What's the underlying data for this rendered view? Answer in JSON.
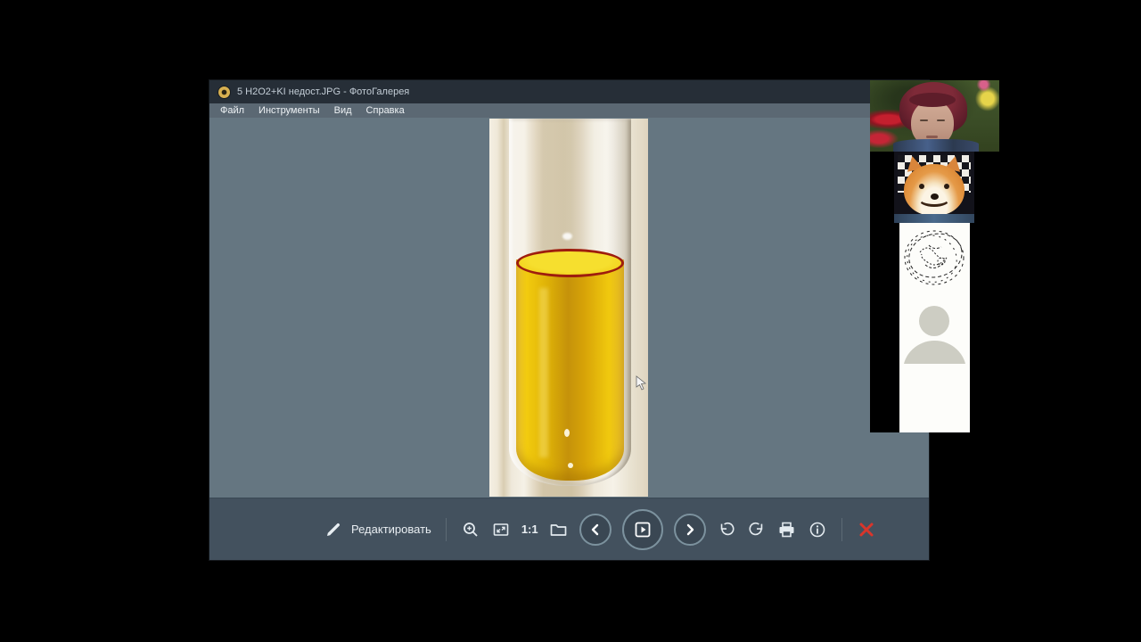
{
  "window": {
    "title": "5 H2O2+KI недост.JPG - ФотоГалерея"
  },
  "menu": {
    "items": [
      "Файл",
      "Инструменты",
      "Вид",
      "Справка"
    ]
  },
  "toolbar": {
    "edit_label": "Редактировать",
    "actual_size_label": "1:1",
    "icons": [
      "edit-pencil",
      "zoom-in",
      "fit-to-window",
      "actual-size-1:1",
      "open-folder",
      "previous",
      "slideshow-play",
      "next",
      "rotate-left",
      "rotate-right",
      "print",
      "info",
      "close"
    ]
  },
  "photo": {
    "subject": "test-tube-with-yellow-liquid",
    "liquid_color": "#d8a40a",
    "meniscus_ring_color": "#9e1d0e",
    "backdrop_color": "#e9e1d0"
  },
  "participants": {
    "tiles": [
      {
        "kind": "webcam-video",
        "icon": "woman-in-garden-video"
      },
      {
        "kind": "avatar",
        "icon": "shiba-dog-avatar"
      },
      {
        "kind": "avatar",
        "icon": "scribble-sketch-avatar"
      },
      {
        "kind": "avatar",
        "icon": "person-silhouette-avatar"
      },
      {
        "kind": "empty",
        "icon": "blank-white-tile"
      }
    ]
  },
  "colors": {
    "titlebar": "#262e37",
    "menubar": "#5b6873",
    "viewer_bg": "#657681",
    "toolbar_bg": "#43515e",
    "close_red": "#d9352b"
  }
}
